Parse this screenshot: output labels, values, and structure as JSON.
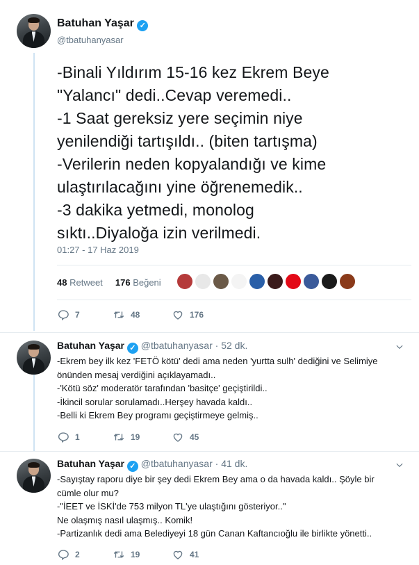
{
  "main_tweet": {
    "author_name": "Batuhan Yaşar",
    "handle": "@tbatuhanyasar",
    "text_lines": [
      "-Binali Yıldırım 15-16 kez Ekrem Beye",
      "\"Yalancı\" dedi..Cevap veremedi..",
      "-1 Saat gereksiz yere seçimin niye",
      "yenilendiği tartışıldı.. (biten tartışma)",
      "-Verilerin neden kopyalandığı ve kime",
      "ulaştırılacağını yine öğrenemedik..",
      "-3 dakika yetmedi, monolog",
      "sıktı..Diyaloğa izin verilmedi."
    ],
    "timestamp": "01:27 - 17 Haz 2019",
    "retweet_count": "48",
    "retweet_label": "Retweet",
    "like_count": "176",
    "like_label": "Beğeni",
    "actions": {
      "replies": "7",
      "retweets": "48",
      "likes": "176"
    },
    "liker_colors": [
      "#b53a3a",
      "#e8e8e8",
      "#6b5a48",
      "#f4f4f4",
      "#2a5fa8",
      "#3a1a1a",
      "#e30a17",
      "#3a5a9a",
      "#1a1a1a",
      "#8a3a1a"
    ]
  },
  "replies": [
    {
      "author_name": "Batuhan Yaşar",
      "handle": "@tbatuhanyasar",
      "time": "52 dk.",
      "text_lines": [
        "-Ekrem bey ilk kez 'FETÖ kötü' dedi ama neden 'yurtta sulh' dediğini ve Selimiye",
        "önünden mesaj verdiğini açıklayamadı..",
        "-'Kötü söz' moderatör tarafından 'basitçe' geçiştirildi..",
        "-İkincil sorular sorulamadı..Herşey havada kaldı..",
        "-Belli ki Ekrem Bey programı geçiştirmeye gelmiş.."
      ],
      "actions": {
        "replies": "1",
        "retweets": "19",
        "likes": "45"
      }
    },
    {
      "author_name": "Batuhan Yaşar",
      "handle": "@tbatuhanyasar",
      "time": "41 dk.",
      "text_lines": [
        "-Sayıştay raporu diye bir şey dedi Ekrem Bey ama o da havada kaldı.. Şöyle bir",
        "cümle olur mu?",
        "-\"İEET ve İSKİ'de 753 milyon TL'ye ulaştığını gösteriyor..\"",
        "Ne olaşmış nasıl ulaşmış.. Komik!",
        "-Partizanlık dedi ama Belediyeyi 18 gün Canan Kaftancıoğlu ile birlikte yönetti.."
      ],
      "actions": {
        "replies": "2",
        "retweets": "19",
        "likes": "41"
      }
    }
  ],
  "separator_dot": "·",
  "verified_mark": "✓"
}
